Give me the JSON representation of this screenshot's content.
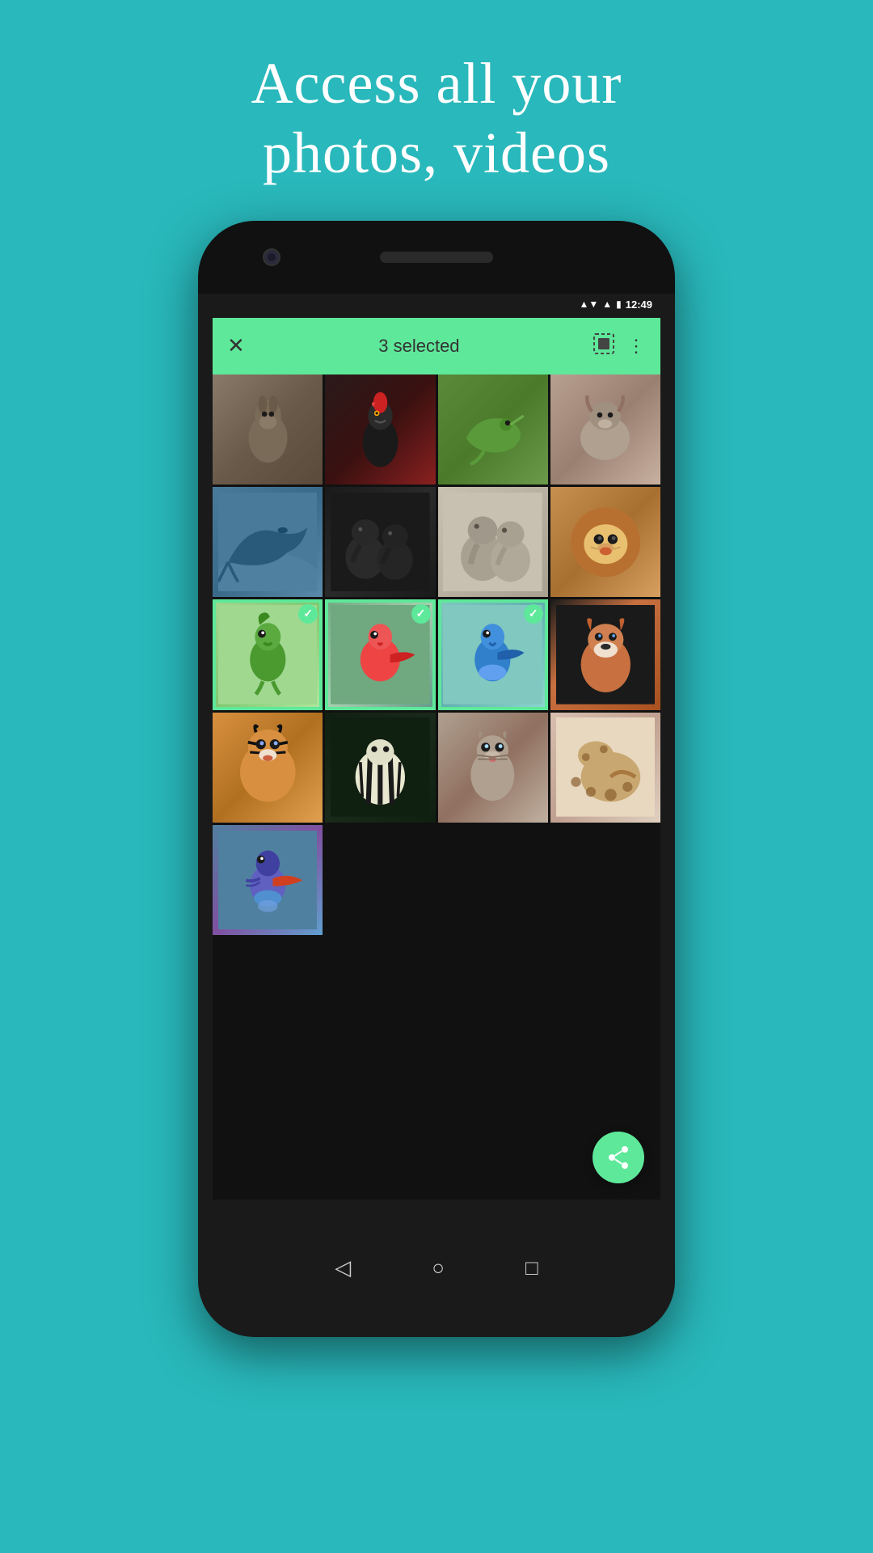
{
  "page": {
    "title_line1": "Access all your",
    "title_line2": "photos, videos"
  },
  "status_bar": {
    "time": "12:49",
    "signal": "▲▼",
    "wifi": "WiFi",
    "battery": "🔋"
  },
  "toolbar": {
    "close_label": "✕",
    "selected_text": "3 selected",
    "select_all_icon": "⬜",
    "more_icon": "⋮"
  },
  "photos": [
    {
      "id": 1,
      "animal": "donkey",
      "css_class": "animal-donkey",
      "selected": false,
      "emoji": ""
    },
    {
      "id": 2,
      "animal": "rooster",
      "css_class": "animal-rooster",
      "selected": false,
      "emoji": ""
    },
    {
      "id": 3,
      "animal": "chameleon",
      "css_class": "animal-chameleon",
      "selected": false,
      "emoji": ""
    },
    {
      "id": 4,
      "animal": "yak",
      "css_class": "animal-yak",
      "selected": false,
      "emoji": ""
    },
    {
      "id": 5,
      "animal": "whale",
      "css_class": "animal-whale",
      "selected": false,
      "emoji": ""
    },
    {
      "id": 6,
      "animal": "elephants-dark",
      "css_class": "animal-elephants-dark",
      "selected": false,
      "emoji": ""
    },
    {
      "id": 7,
      "animal": "elephants",
      "css_class": "animal-elephants",
      "selected": false,
      "emoji": ""
    },
    {
      "id": 8,
      "animal": "lion",
      "css_class": "animal-lion",
      "selected": false,
      "emoji": ""
    },
    {
      "id": 9,
      "animal": "parrot-green",
      "css_class": "animal-parrot-green",
      "selected": true,
      "emoji": ""
    },
    {
      "id": 10,
      "animal": "bird-red",
      "css_class": "animal-bird-red",
      "selected": true,
      "emoji": ""
    },
    {
      "id": 11,
      "animal": "bird-blue",
      "css_class": "animal-bird-blue",
      "selected": true,
      "emoji": ""
    },
    {
      "id": 12,
      "animal": "fox",
      "css_class": "animal-fox",
      "selected": false,
      "emoji": ""
    },
    {
      "id": 13,
      "animal": "tiger",
      "css_class": "animal-tiger",
      "selected": false,
      "emoji": ""
    },
    {
      "id": 14,
      "animal": "zebra",
      "css_class": "animal-zebra",
      "selected": false,
      "emoji": ""
    },
    {
      "id": 15,
      "animal": "cat",
      "css_class": "animal-cat",
      "selected": false,
      "emoji": ""
    },
    {
      "id": 16,
      "animal": "leopard",
      "css_class": "animal-leopard",
      "selected": false,
      "emoji": ""
    },
    {
      "id": 17,
      "animal": "kingfisher",
      "css_class": "animal-kingfisher",
      "selected": false,
      "emoji": ""
    }
  ],
  "fab": {
    "icon": "share",
    "label": "Share"
  },
  "nav": {
    "back_icon": "◁",
    "home_icon": "○",
    "recents_icon": "□"
  },
  "colors": {
    "background": "#29b8bb",
    "toolbar_bg": "#5ee89a",
    "fab_bg": "#5ee89a",
    "phone_frame": "#1a1a1a"
  }
}
